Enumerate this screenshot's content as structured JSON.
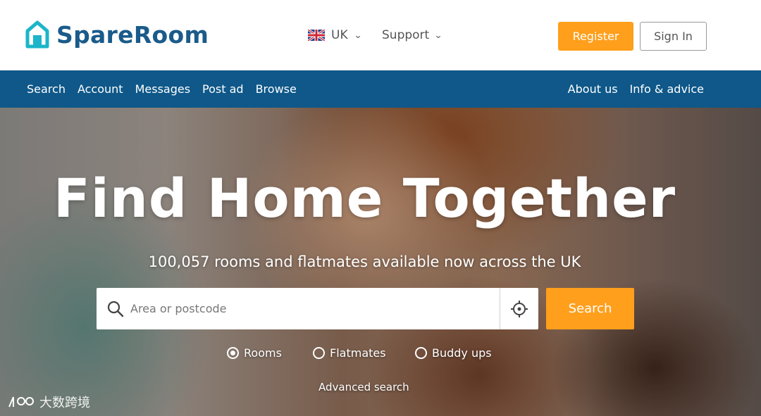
{
  "header": {
    "logo_text": "SpareRoom",
    "country": "UK",
    "support": "Support",
    "register": "Register",
    "sign_in": "Sign In"
  },
  "nav": {
    "left": [
      {
        "label": "Search"
      },
      {
        "label": "Account"
      },
      {
        "label": "Messages"
      },
      {
        "label": "Post ad"
      },
      {
        "label": "Browse"
      }
    ],
    "right": [
      {
        "label": "About us"
      },
      {
        "label": "Info & advice"
      }
    ]
  },
  "hero": {
    "title": "Find Home Together",
    "subtitle": "100,057 rooms and flatmates available now across the UK",
    "search_placeholder": "Area or postcode",
    "search_button": "Search",
    "options": [
      {
        "label": "Rooms",
        "selected": true
      },
      {
        "label": "Flatmates",
        "selected": false
      },
      {
        "label": "Buddy ups",
        "selected": false
      }
    ],
    "advanced_search": "Advanced search"
  },
  "watermark": "大数跨境",
  "colors": {
    "brand_blue": "#1a5b8a",
    "nav_blue": "#0f5889",
    "accent_orange": "#ff9f1c",
    "logo_teal": "#1cb5c9"
  },
  "icons": [
    "house-logo-icon",
    "uk-flag-icon",
    "chevron-down-icon",
    "search-icon",
    "crosshair-locate-icon",
    "radio-icon"
  ]
}
